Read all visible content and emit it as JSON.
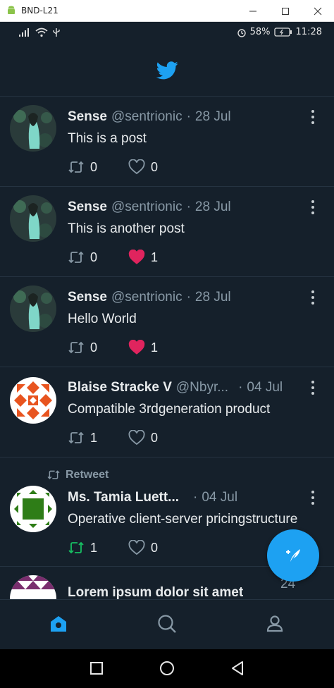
{
  "window": {
    "title": "BND-L21",
    "icon": "android-icon",
    "controls": [
      "minimize-icon",
      "maximize-icon",
      "close-icon"
    ]
  },
  "statusbar": {
    "battery_percent": "58%",
    "time": "11:28",
    "icons": [
      "signal-icon",
      "wifi-icon",
      "usb-icon",
      "alarm-icon",
      "battery-icon"
    ]
  },
  "topbar": {
    "logo": "twitter-bird-icon",
    "accent": "#1da1f2"
  },
  "tweets": [
    {
      "name": "Sense",
      "handle": "@sentrionic",
      "separator": "·",
      "date": "28 Jul",
      "text": "This is a post",
      "retweets": "0",
      "likes": "0",
      "liked": false
    },
    {
      "name": "Sense",
      "handle": "@sentrionic",
      "separator": "·",
      "date": "28 Jul",
      "text": "This is another post",
      "retweets": "0",
      "likes": "1",
      "liked": true
    },
    {
      "name": "Sense",
      "handle": "@sentrionic",
      "separator": "·",
      "date": "28 Jul",
      "text": "Hello World",
      "retweets": "0",
      "likes": "1",
      "liked": true
    },
    {
      "name": "Blaise Stracke V",
      "handle": "@Nbyr...",
      "separator": "·",
      "date": "04 Jul",
      "text": "Compatible 3rdgeneration product",
      "retweets": "1",
      "likes": "0",
      "liked": false
    },
    {
      "retweet_label": "Retweet",
      "name": "Ms. Tamia Luett...",
      "handle": "",
      "separator": "·",
      "date": "04 Jul",
      "text": "Operative client-server pricingstructure",
      "retweets": "1",
      "likes": "0",
      "liked": false,
      "retweeted": true
    },
    {
      "name": "Lorem ipsum dolor sit amet",
      "date": "24"
    }
  ],
  "fab": {
    "icon": "compose-tweet-icon"
  },
  "bottom_nav": [
    "home-icon",
    "search-icon",
    "profile-icon"
  ],
  "system_nav": [
    "recents-icon",
    "home-circle-icon",
    "back-icon"
  ],
  "colors": {
    "background": "#15202b",
    "divider": "#253341",
    "primary_text": "#e8ebed",
    "secondary_text": "#8899a6",
    "like_red": "#e0245e",
    "retweet_green": "#17bf63"
  }
}
